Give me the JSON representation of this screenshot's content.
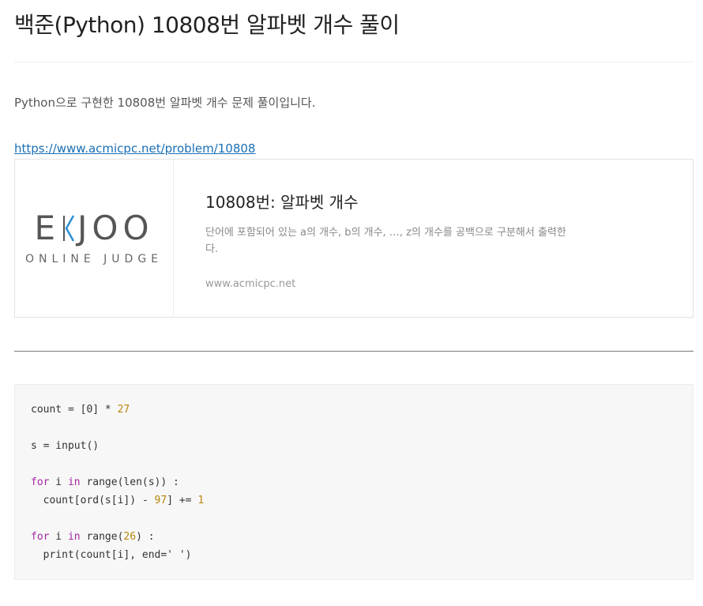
{
  "post": {
    "title": "백준(Python) 10808번 알파벳 개수 풀이",
    "intro": "Python으로 구현한 10808번 알파벳 개수 문제 풀이입니다.",
    "link_text": "https://www.acmicpc.net/problem/10808"
  },
  "card": {
    "logo_word_left": "E",
    "logo_word_right": "JOO",
    "logo_sub": "ONLINE JUDGE",
    "title": "10808번: 알파벳 개수",
    "description": "단어에 포함되어 있는 a의 개수, b의 개수, …, z의 개수를 공백으로 구분해서 출력한다.",
    "domain": "www.acmicpc.net"
  },
  "colors": {
    "link": "#1a6fb5",
    "logo_accent": "#2b8fd6",
    "keyword": "#a626a4",
    "number": "#b8860b"
  },
  "code": {
    "l1a": "count = [0] * ",
    "l1b": "27",
    "l2": "s = input()",
    "l3_for": "for",
    "l3_mid": " i ",
    "l3_in": "in",
    "l3_rest": " range(len(s)) :",
    "l4a": "  count[ord(s[i]) - ",
    "l4b": "97",
    "l4c": "] += ",
    "l4d": "1",
    "l5_for": "for",
    "l5_mid": " i ",
    "l5_in": "in",
    "l5_a": " range(",
    "l5_b": "26",
    "l5_c": ") :",
    "l6": "  print(count[i], end=' ')"
  }
}
